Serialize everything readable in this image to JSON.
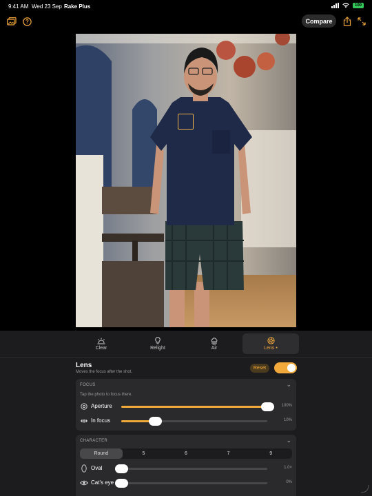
{
  "status_bar": {
    "time": "9:41 AM",
    "date": "Wed 23 Sep",
    "app": "Rake Plus",
    "battery": "100"
  },
  "toolbar": {
    "left_icons": [
      "gallery-icon",
      "help-icon"
    ],
    "compare_label": "Compare",
    "right_icons": [
      "share-icon",
      "expand-icon"
    ]
  },
  "tabs": [
    {
      "label": "Clear",
      "icon": "sun-icon"
    },
    {
      "label": "Relight",
      "icon": "bulb-icon"
    },
    {
      "label": "Air",
      "icon": "cloud-icon"
    },
    {
      "label": "Lens •",
      "icon": "aperture-icon",
      "active": true
    }
  ],
  "lens": {
    "title": "Lens",
    "subtitle": "Moves the focus after the shot.",
    "reset_label": "Reset",
    "enabled": true
  },
  "focus": {
    "title": "FOCUS",
    "hint": "Tap the photo to focus there.",
    "aperture": {
      "label": "Aperture",
      "value_text": "100%",
      "level": 1.0
    },
    "in_focus": {
      "label": "In focus",
      "value_text": "10%",
      "level": 0.23
    }
  },
  "character": {
    "title": "CHARACTER",
    "segments": [
      "Round",
      "5",
      "6",
      "7",
      "9"
    ],
    "selected": "Round",
    "oval": {
      "label": "Oval",
      "value_text": "1.0×",
      "level": 0.0
    },
    "cats_eye": {
      "label": "Cat's eye",
      "value_text": "0%",
      "level": 0.0
    }
  },
  "colors": {
    "accent": "#f2a93b",
    "panel": "#1c1c1e",
    "card": "#2a2a2c"
  }
}
